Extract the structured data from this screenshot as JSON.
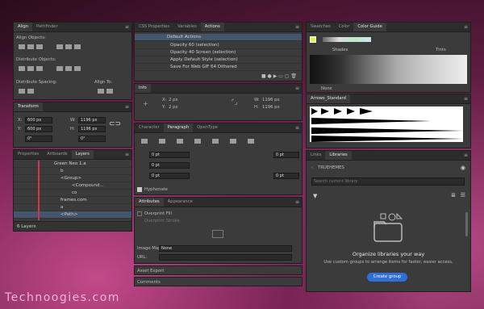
{
  "align": {
    "tabs": [
      "Align",
      "Pathfinder"
    ],
    "align_objects": "Align Objects:",
    "distribute_objects": "Distribute Objects:",
    "distribute_spacing": "Distribute Spacing:",
    "align_to": "Align To:"
  },
  "transform": {
    "title": "Transform",
    "x": "600 px",
    "y": "600 px",
    "w": "1196 px",
    "h": "1196 px",
    "angle": "0°",
    "shear": "0°"
  },
  "layers": {
    "tabs": [
      "Properties",
      "Artboards",
      "Layers"
    ],
    "rows": [
      "Green Neo 1.a",
      "b",
      "<Group>",
      "<Compound...",
      "co",
      "frames.com",
      "a",
      "<Path>"
    ],
    "footer": "6 Layers"
  },
  "actions": {
    "tabs": [
      "CSS Properties",
      "Variables",
      "Actions"
    ],
    "rows": [
      "Default Actions",
      "Opacity 60 (selection)",
      "Opacity 40 Screen (selection)",
      "Apply Default Style (selection)",
      "Save For Web GIF 64 Dithered"
    ]
  },
  "info": {
    "title": "Info",
    "x": "2 px",
    "y": "2 px",
    "w": "1196 px",
    "h": "1196 px"
  },
  "paragraph": {
    "tabs": [
      "Character",
      "Paragraph",
      "OpenType"
    ],
    "left_indent": "0 pt",
    "first_indent": "0 pt",
    "right_indent": "0 pt",
    "space_before": "0 pt",
    "space_after": "0 pt",
    "hyphenate": "Hyphenate"
  },
  "attributes": {
    "tabs": [
      "Attributes",
      "Appearance"
    ],
    "overprint_fill": "Overprint Fill",
    "overprint_stroke": "Overprint Stroke",
    "image_map": "Image Map:",
    "image_map_value": "None",
    "url": "URL:"
  },
  "asset_export": "Asset Export",
  "comments": "Comments",
  "swatches": {
    "tabs": [
      "Swatches",
      "Color",
      "Color Guide"
    ],
    "shades": "Shades",
    "tints": "Tints",
    "footer": "None"
  },
  "arrows": {
    "title": "Arrows_Standard"
  },
  "libraries": {
    "tabs": [
      "Links",
      "Libraries"
    ],
    "account": "TRUEHEMES",
    "search": "Search current library",
    "heading": "Organize libraries your way",
    "body": "Use custom groups to arrange items for faster, easier access.",
    "button": "Create group"
  },
  "watermark": "Technoogies.com",
  "colors": {
    "accent": "#2f6fd6",
    "panel": "#3b3b3b",
    "selection": "#46556e"
  }
}
